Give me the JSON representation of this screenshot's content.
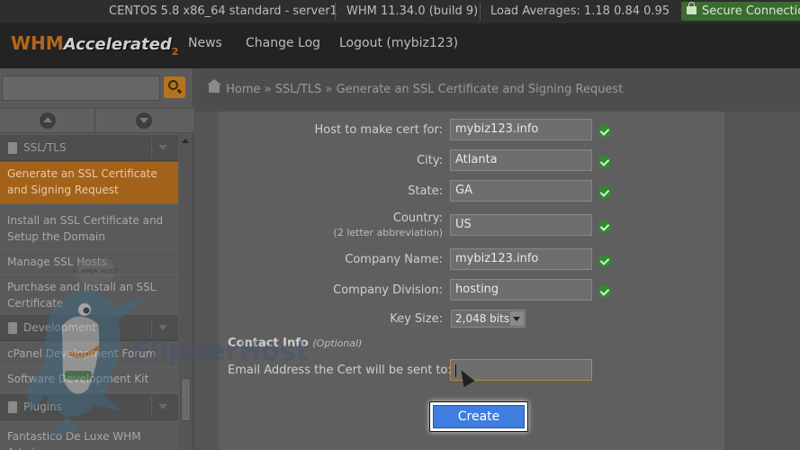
{
  "status": {
    "os": "CENTOS 5.8 x86_64 standard - server1",
    "version": "WHM 11.34.0 (build 9)",
    "load": "Load Averages: 1.18 0.84 0.95",
    "secure": "Secure Connection"
  },
  "header": {
    "logo_main": "WHM",
    "logo_sub": "Accelerated",
    "logo_num": "2",
    "nav": [
      "News",
      "Change Log",
      "Logout (mybiz123)"
    ]
  },
  "sidebar": {
    "section_ssl": "SSL/TLS",
    "items": [
      "Generate an SSL Certificate and Signing Request",
      "Install an SSL Certificate and Setup the Domain",
      "Manage SSL Hosts",
      "Purchase and Install an SSL Certificate"
    ],
    "section_dev": "Development",
    "dev_items": [
      "cPanel Development Forum",
      "Software Development Kit"
    ],
    "section_plugins": "Plugins",
    "plugin_items": [
      "Fantastico De Luxe WHM Admin"
    ]
  },
  "breadcrumb": {
    "home": "Home",
    "sep": "»",
    "ssl": "SSL/TLS",
    "page": "Generate an SSL Certificate and Signing Request"
  },
  "form": {
    "host_label": "Host to make cert for:",
    "host_value": "mybiz123.info",
    "city_label": "City:",
    "city_value": "Atlanta",
    "state_label": "State:",
    "state_value": "GA",
    "country_label": "Country:",
    "country_sublabel": "(2 letter abbreviation)",
    "country_value": "US",
    "company_label": "Company Name:",
    "company_value": "mybiz123.info",
    "division_label": "Company Division:",
    "division_value": "hosting",
    "keysize_label": "Key Size:",
    "keysize_value": "2,048 bits",
    "contact_heading": "Contact Info",
    "contact_optional": "(Optional)",
    "email_label": "Email Address the Cert will be sent to:",
    "email_value": "",
    "create_label": "Create"
  },
  "watermark": {
    "text": "FlipperHost",
    "badge": "FLIPPER HOST"
  }
}
